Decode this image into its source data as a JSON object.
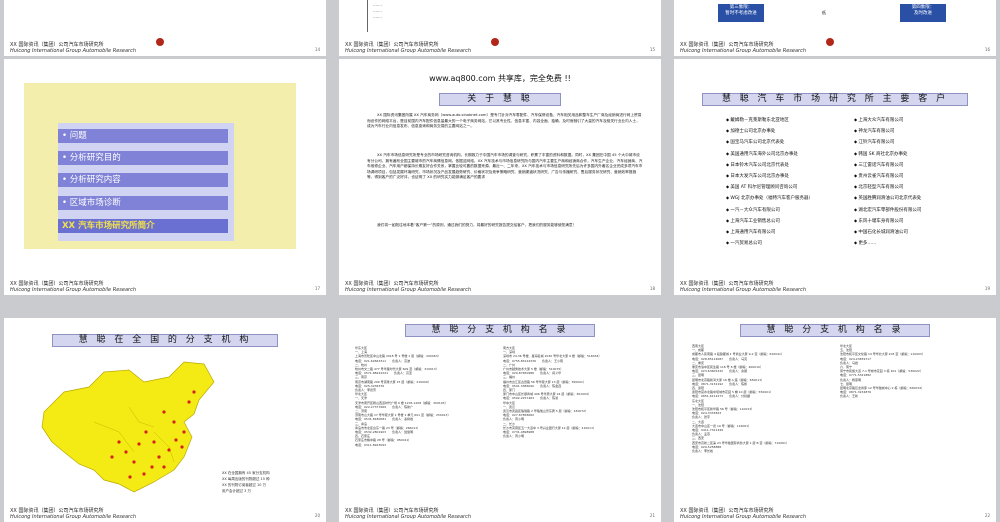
{
  "footer": {
    "cn": "XX 国际资讯（集团）公司汽车市场研究所",
    "en": "Huicong International Group Automobile Research"
  },
  "row0": {
    "slide15_list": ".......\n.......\n.......",
    "slide16_stage3": "第三象限：\n暂时不考虑改进",
    "slide16_stage4": "第四象限：\n及时改进",
    "slide16_mark": "低",
    "pages": [
      "14",
      "15",
      "16"
    ]
  },
  "slide17": {
    "items": [
      "问题",
      "分析研究目的",
      "分析研究内容",
      "区域市场诊断",
      "XX 汽车市场研究所简介"
    ],
    "page": "17"
  },
  "slide18": {
    "banner": "www.aq800.com  共享库，完全免费 !!",
    "title": "关 于 慧 聪",
    "para1": "XX 国际资讯集团所属 XX 汽车商务网（www.auto.sinobnet.com）是专门针对汽车零配件、汽车保修设备、汽车相关用品和整车生产厂商及经销商进行网上贸易而设作的网络平台，是目前国内汽车配件信息量最大的一个电子商务网站，它以其专业性、信息丰富、内容全面、独确、及时而驰引了大量的汽车及相关行业业内人士，成为汽车行业内信息发布、信息查询和商务交易的主要网站之一。",
    "para2": "XX 汽车市场信息研究所是专业的市场研究咨询机构，长期致力于中国汽车市场的调查与研究，积累了丰富的资料和数据。同时，XX 集团在中国 45 个大中城市设有分公司，拥有遍布全国主要城市的汽车商情信息网。依据这网络，XX 汽车技术与市场信息研究所与国内汽车主要生产商和经销商合作，汽车生产企业、汽车经销商、汽车维修企业、汽车用户都保持长期友好合作关系，掌握比较可靠的数据来源。最近一、二年来，XX 汽车技术与市场信息研究所先后为许多国内外著名企业完成多项汽车市场调研项目，包括发展环境研究、市场状况及产品发展趋势研究、价格状况及竞争策略研究、营销渠道状况研究、广告与传播研究、售后服务状况研究、营销效率措施等，得到客户的广泛好评，也证明了 XX 的研究实力能够满足客户的要求",
    "para3": "我们将一如既往地本着“客户第一”的原则，通过我们的努力，将最好的研究报告提交给客户，把我们的服务能够使您满意！",
    "page": "18"
  },
  "slide19": {
    "title": "慧 聪 汽 车 市 场 研 究 所 主 要 客 户",
    "left": [
      "戴姆勒－克莱斯勒东北亚地区",
      "加德士公司北京办事处",
      "国宝马汽车公司北京代表处",
      "美国通用汽车海外公司北京办事处",
      "日本铃木汽车公司北京代表处",
      "日本大发汽车公司北京办事处",
      "美国 AT 科尔尼管理顾问咨询公司",
      "WGJ 北京办事处（福特汽车客户服务器）",
      "一汽－大众汽车有限公司",
      "上海汽车工业销售总公司",
      "上海通用汽车有限公司",
      "一汽贸易总公司"
    ],
    "right": [
      "上海大众汽车有限公司",
      "神龙汽车有限公司",
      "江铃汽车有限公司",
      "韩国 SK 商社北京办事处",
      "三江雷诺汽车有限公司",
      "贵州云雀汽车有限公司",
      "北京轻型汽车有限公司",
      "英国胜腾润滑油公司北京代表处",
      "湖北宏汽车零部件股份有限公司",
      "东风十堰车身有限公司",
      "中国石化长城润滑油公司",
      "更多……"
    ],
    "page": "19"
  },
  "slide20": {
    "title": "慧 聪 在 全 国 的 分 支 机 构",
    "legend": [
      "XX 在全国拥有 45 家分支机构",
      "XX 每周出版的刊物超过 15 种",
      "XX 的刊物订阅者超过 10 万",
      "用户会计超过 3 万"
    ],
    "page": "20"
  },
  "slide21": {
    "title": "慧 聪 分 支 机 构 名 录",
    "col1": "华东大区\n一、上海\n上海市普陀区中山北路 2918 号 1 号楼 1 层（邮编：200063）\n电话：021-62663311　　负责人：高波\n二、杭州\n杭州市文二路 477 号华星时代大厦 609 室（邮编：310013）\n电话：0571-88222241　　负责人：高圣\n三、南京\n南京市湖南路 299 号京隆大厦 15 层（邮编：210009）\n电话：025-3236376\n负责人：李德芳\n华北大区\n一、天津\n天津市南开区鞍山西道时代广场 6 楼 1205-1208（邮编：300193）\n电话：022-27377669　　负责人：陈新广\n二、济南\n济南市山大路 17 号华夏大厦 1 号楼 1 单元 601 室（邮编：250013）\n电话：0531-8180081　　负责人：秦树峰\n三、青岛\n青岛市市北区台东一路 23 号（邮编：266011）\n电话：0532-2801903　　负责人：聂俊明\n四、石家庄\n石家庄市槐中路 28 号（邮编：050021）\n电话：0311-8923093",
    "col2": "南方大区\n一、深圳\n深圳市 24-36 号楼、星海名城 2030 号华北大厦 6 楼（邮编：518034）\n电话：0755-83124336　　负责人：王小雨\n二、广州\n广州市越秀技术大厦 5 楼（邮编：510075）\n电话：020-87650986　　负责人：蒋义华\n三、福州\n福州市台江区古田路 56 号华夏大厦 13 层（邮编：350001）\n电话：0591-3386090　　负责人：陈金连\n四、厦门\n厦门市中山区长顺商城 406 号华男大厦 24 层（邮编：361004）\n电话：0592-2257463　　负责人：陈淑\n华中大区\n一、武汉\n武汉市武昌区珞珈路 2 号珞珈山景东宾 5 层（邮编：430072）\n电话：027-87858062\n负责人：周小明\n二、长沙\n长沙市芙蓉区五一大道中 3 号兴业银行大厦 12 层（邮编：410011）\n电话：0731-4898988\n负责人：周小明",
    "page": "21"
  },
  "slide22": {
    "title": "慧 聪 分 支 机 构 名 录",
    "col1": "西南大区\n一、成都\n成都市人民南路 4 段锦都城 1 号商业大厦 9-2 室（邮编：610041）\n电话：028-85114087　　负责人：马克\n二、重庆\n重庆市渝中区民生路 118 号 8 楼（邮编：400010）\n电话：023-63605332　　负责人：余振\n三、昆明\n昆明市北京路新鸿大厦 16 楼 A 座（邮编：650011）\n电话：0871-3132192　　负责人：陈鹤\n四、贵阳\n贵阳市富水北路中坝城市花园 5 幢 10 层（邮编：550001）\n电话：0851-6112273　　负责人：付秋麟\n东北大区\n一、沈阳\n沈阳市和平区新华路 56 号（邮编：110013）\n电话：024-3333823\n负责人：张宇\n二、大连\n大连市中山区一德 19 号（邮编：116001）\n电话：0411-7321349\n负责人：孟燕\n三、西安\n西安市高新二区第 23 号华融国际商务大厦 1 层 B 室（邮编：710061）\n电话：029-5258888\n负责人：李长峰",
    "col2": "华北大区\n五、沈阳\n沈阳市和平区文化路 14 号华北大厦 203 室（邮编：110003）\n电话：024-23839717\n负责人：马岩\n六、南宁\n南宁市民族大道 7-1 号城市花园 3 栋 401（邮编：530022）\n电话：0771-5321882\n负责人：杨恩明\n七、昆明\n昆明北京路巨龙商厦 12 号华融城中心 2 栋（邮编：650034）\n电话：0871-3234876\n负责人：王新",
    "page": "22"
  }
}
